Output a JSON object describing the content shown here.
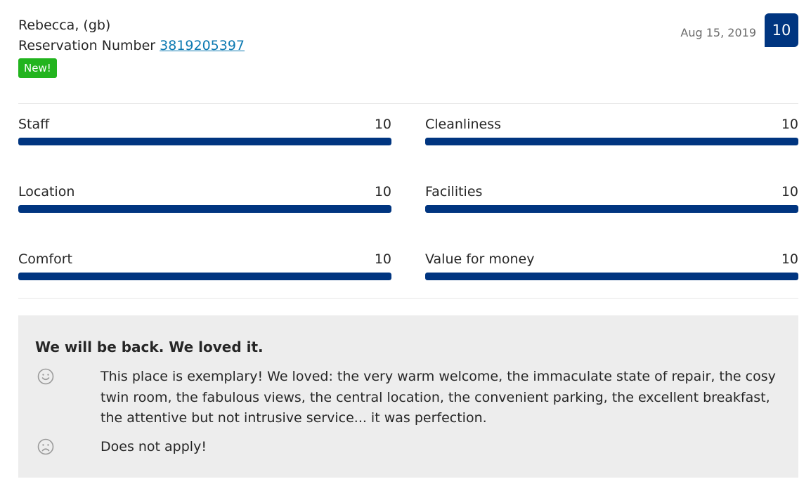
{
  "reviewer": {
    "name": "Rebecca, (gb)",
    "reservation_label": "Reservation Number",
    "reservation_number": "3819205397",
    "badge": "New!"
  },
  "header": {
    "date": "Aug 15, 2019",
    "score": "10"
  },
  "categories": [
    {
      "label": "Staff",
      "value": "10",
      "fraction": 1.0
    },
    {
      "label": "Cleanliness",
      "value": "10",
      "fraction": 1.0
    },
    {
      "label": "Location",
      "value": "10",
      "fraction": 1.0
    },
    {
      "label": "Facilities",
      "value": "10",
      "fraction": 1.0
    },
    {
      "label": "Comfort",
      "value": "10",
      "fraction": 1.0
    },
    {
      "label": "Value for money",
      "value": "10",
      "fraction": 1.0
    }
  ],
  "review": {
    "title": "We will be back. We loved it.",
    "positive_icon": "smile-icon",
    "positive": "This place is exemplary! We loved: the very warm welcome, the immaculate state of repair, the cosy twin room, the fabulous views, the central location, the convenient parking, the excellent breakfast, the attentive but not intrusive service... it was perfection.",
    "negative_icon": "frown-icon",
    "negative": "Does not apply!"
  },
  "colors": {
    "brand_blue": "#003580",
    "new_green": "#22b41e",
    "link_blue": "#0d7ab2",
    "review_bg": "#ededed"
  }
}
